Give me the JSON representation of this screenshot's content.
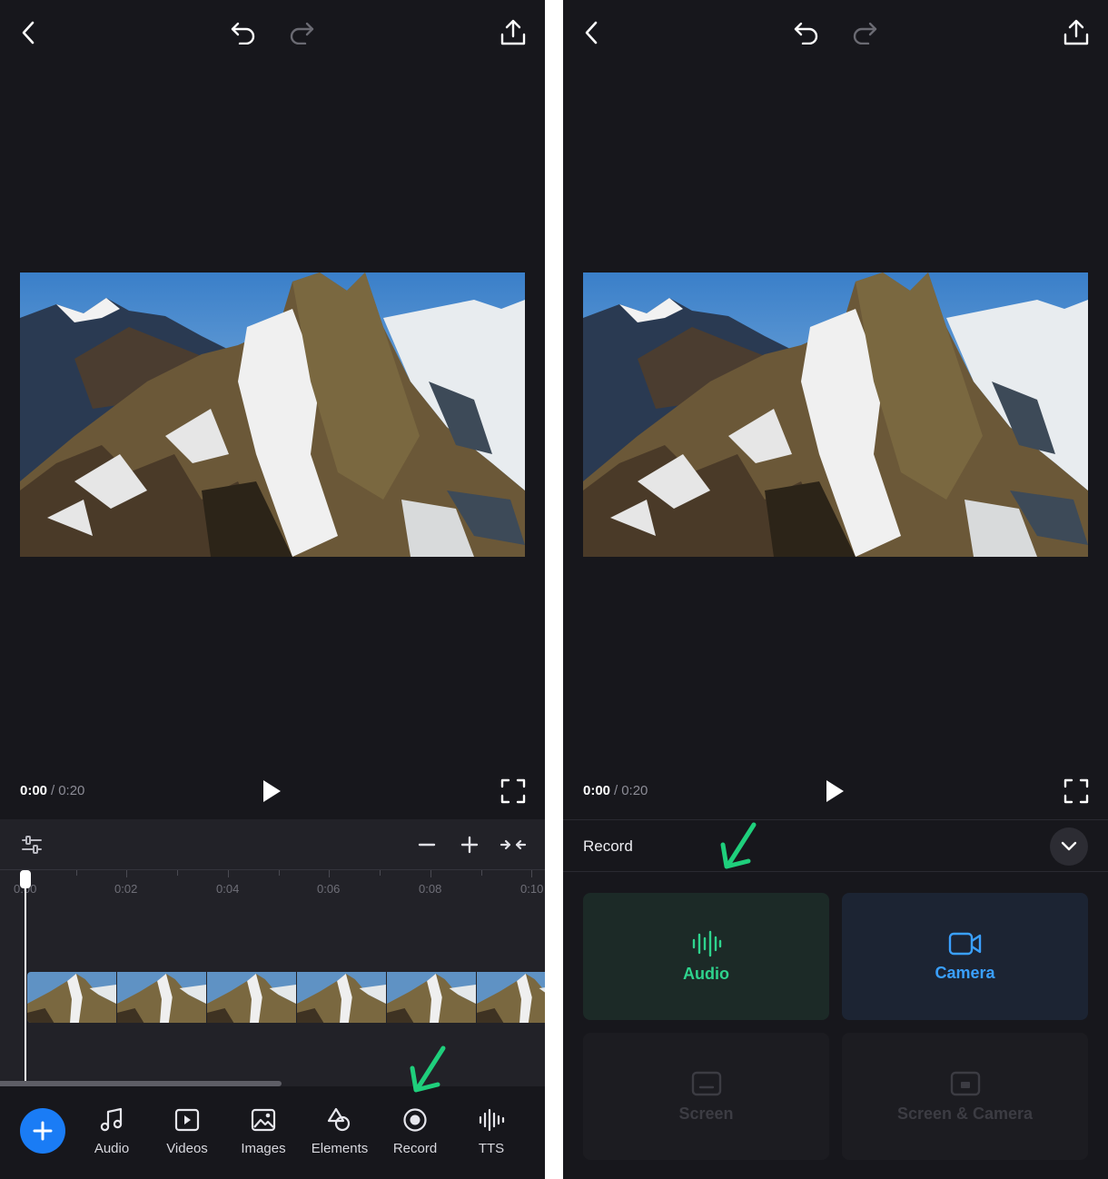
{
  "colors": {
    "background": "#17171c",
    "panel": "#222228",
    "accent_blue": "#1a7cf5",
    "audio_green": "#2ed38d",
    "camera_blue": "#3aa0ff",
    "annotation_green": "#1fcf7c"
  },
  "left": {
    "topbar": {
      "icons": [
        "chevron-left-icon",
        "undo-icon",
        "redo-icon",
        "share-icon"
      ]
    },
    "playback": {
      "current_time": "0:00",
      "separator": "/",
      "total_time": "0:20"
    },
    "timeline": {
      "ticks": [
        "0:00",
        "0:02",
        "0:04",
        "0:06",
        "0:08",
        "0:10"
      ],
      "tools": [
        "adjust-icon",
        "zoom-out-icon",
        "zoom-in-icon",
        "fit-icon"
      ]
    },
    "toolbar": {
      "items": [
        {
          "label": "Audio",
          "icon": "music-note-icon"
        },
        {
          "label": "Videos",
          "icon": "video-play-icon"
        },
        {
          "label": "Images",
          "icon": "image-icon"
        },
        {
          "label": "Elements",
          "icon": "shapes-icon"
        },
        {
          "label": "Record",
          "icon": "record-icon"
        },
        {
          "label": "TTS",
          "icon": "waveform-icon"
        }
      ]
    }
  },
  "right": {
    "playback": {
      "current_time": "0:00",
      "separator": "/",
      "total_time": "0:20"
    },
    "record_panel": {
      "title": "Record",
      "options": [
        {
          "label": "Audio",
          "icon": "audio-waveform-icon",
          "state": "active"
        },
        {
          "label": "Camera",
          "icon": "camera-icon",
          "state": "active"
        },
        {
          "label": "Screen",
          "icon": "screen-icon",
          "state": "disabled"
        },
        {
          "label": "Screen & Camera",
          "icon": "screen-camera-icon",
          "state": "disabled"
        }
      ]
    }
  }
}
